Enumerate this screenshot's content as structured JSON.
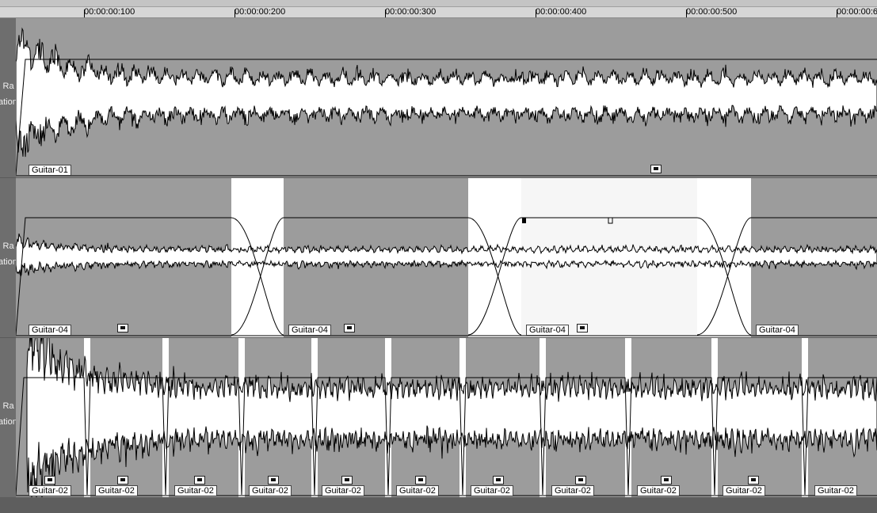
{
  "ruler": {
    "labels": [
      "00:00:00:100",
      "00:00:00:200",
      "00:00:00:300",
      "00:00:00:400",
      "00:00:00:500",
      "00:00:00:6"
    ]
  },
  "tracks": [
    {
      "header_lines": [
        "l Ra",
        "ation"
      ],
      "clips": [
        {
          "label": "Guitar-01",
          "icon": "fx-plug-icon"
        }
      ]
    },
    {
      "header_lines": [
        "l Ra",
        "ation"
      ],
      "clips": [
        {
          "label": "Guitar-04",
          "icon": "fx-plug-icon"
        },
        {
          "label": "Guitar-04",
          "icon": "fx-plug-icon"
        },
        {
          "label": "Guitar-04",
          "icon": "fx-plug-icon"
        },
        {
          "label": "Guitar-04",
          "icon": "none"
        }
      ]
    },
    {
      "header_lines": [
        "l Ra",
        "ation"
      ],
      "clips": [
        {
          "label": "Guitar-02",
          "icon": "fx-plug-icon"
        },
        {
          "label": "Guitar-02",
          "icon": "fx-plug-icon"
        },
        {
          "label": "Guitar-02",
          "icon": "fx-plug-icon"
        },
        {
          "label": "Guitar-02",
          "icon": "fx-plug-icon"
        },
        {
          "label": "Guitar-02",
          "icon": "fx-plug-icon"
        },
        {
          "label": "Guitar-02",
          "icon": "fx-plug-icon"
        },
        {
          "label": "Guitar-02",
          "icon": "fx-plug-icon"
        },
        {
          "label": "Guitar-02",
          "icon": "fx-plug-icon"
        },
        {
          "label": "Guitar-02",
          "icon": "fx-plug-icon"
        },
        {
          "label": "Guitar-02",
          "icon": "fx-plug-icon"
        },
        {
          "label": "Guitar-02",
          "icon": "none"
        }
      ]
    }
  ],
  "colors": {
    "clip_bg": "#9c9c9c",
    "crossfade_bg": "#ffffff",
    "selected_clip_bg": "#f6f6f6",
    "waveform_fill": "#ffffff",
    "waveform_stroke": "#000000"
  }
}
